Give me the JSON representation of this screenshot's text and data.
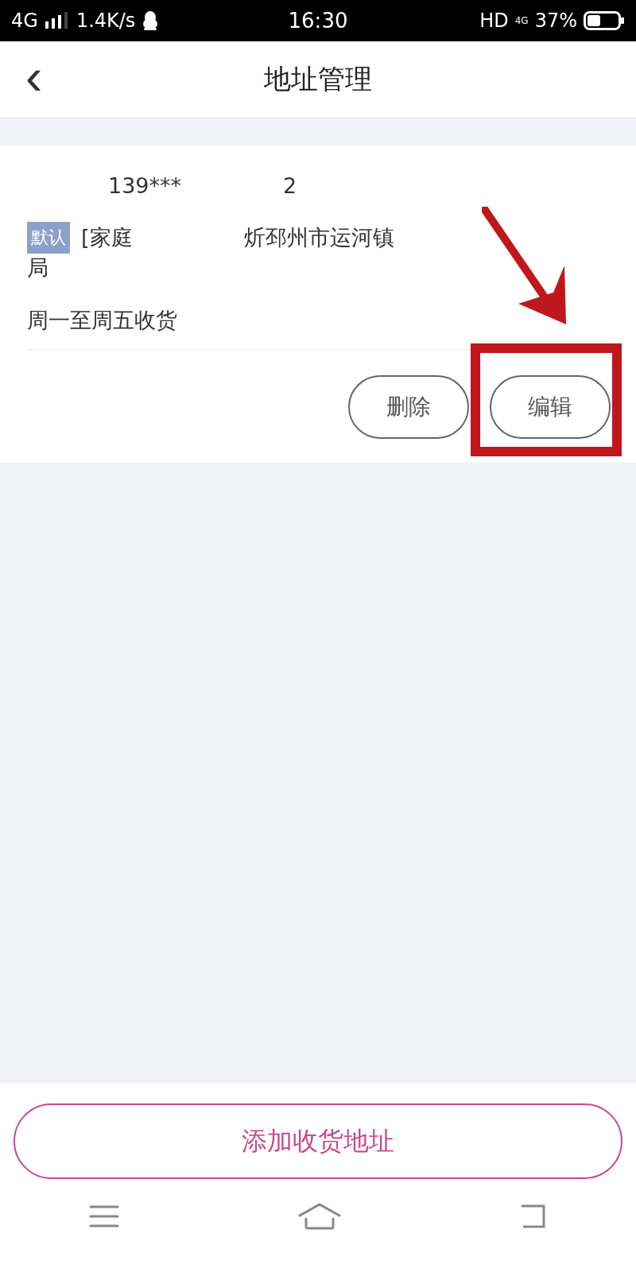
{
  "status_bar": {
    "network": "4G",
    "speed": "1.4K/s",
    "time": "16:30",
    "hd": "HD",
    "network_small": "4G",
    "battery": "37%"
  },
  "header": {
    "back": "‹",
    "title": "地址管理"
  },
  "address_card": {
    "phone": "139***",
    "phone_tail": "2",
    "tag": "默认",
    "address_lines": [
      [
        "[家庭",
        "炘邳州市运河镇"
      ],
      [
        "局"
      ]
    ],
    "delivery_time": "周一至周五收货",
    "buttons": [
      {
        "label": "删除",
        "highlighted": false
      },
      {
        "label": "编辑",
        "highlighted": true
      }
    ]
  },
  "add_button": "添加收货地址"
}
